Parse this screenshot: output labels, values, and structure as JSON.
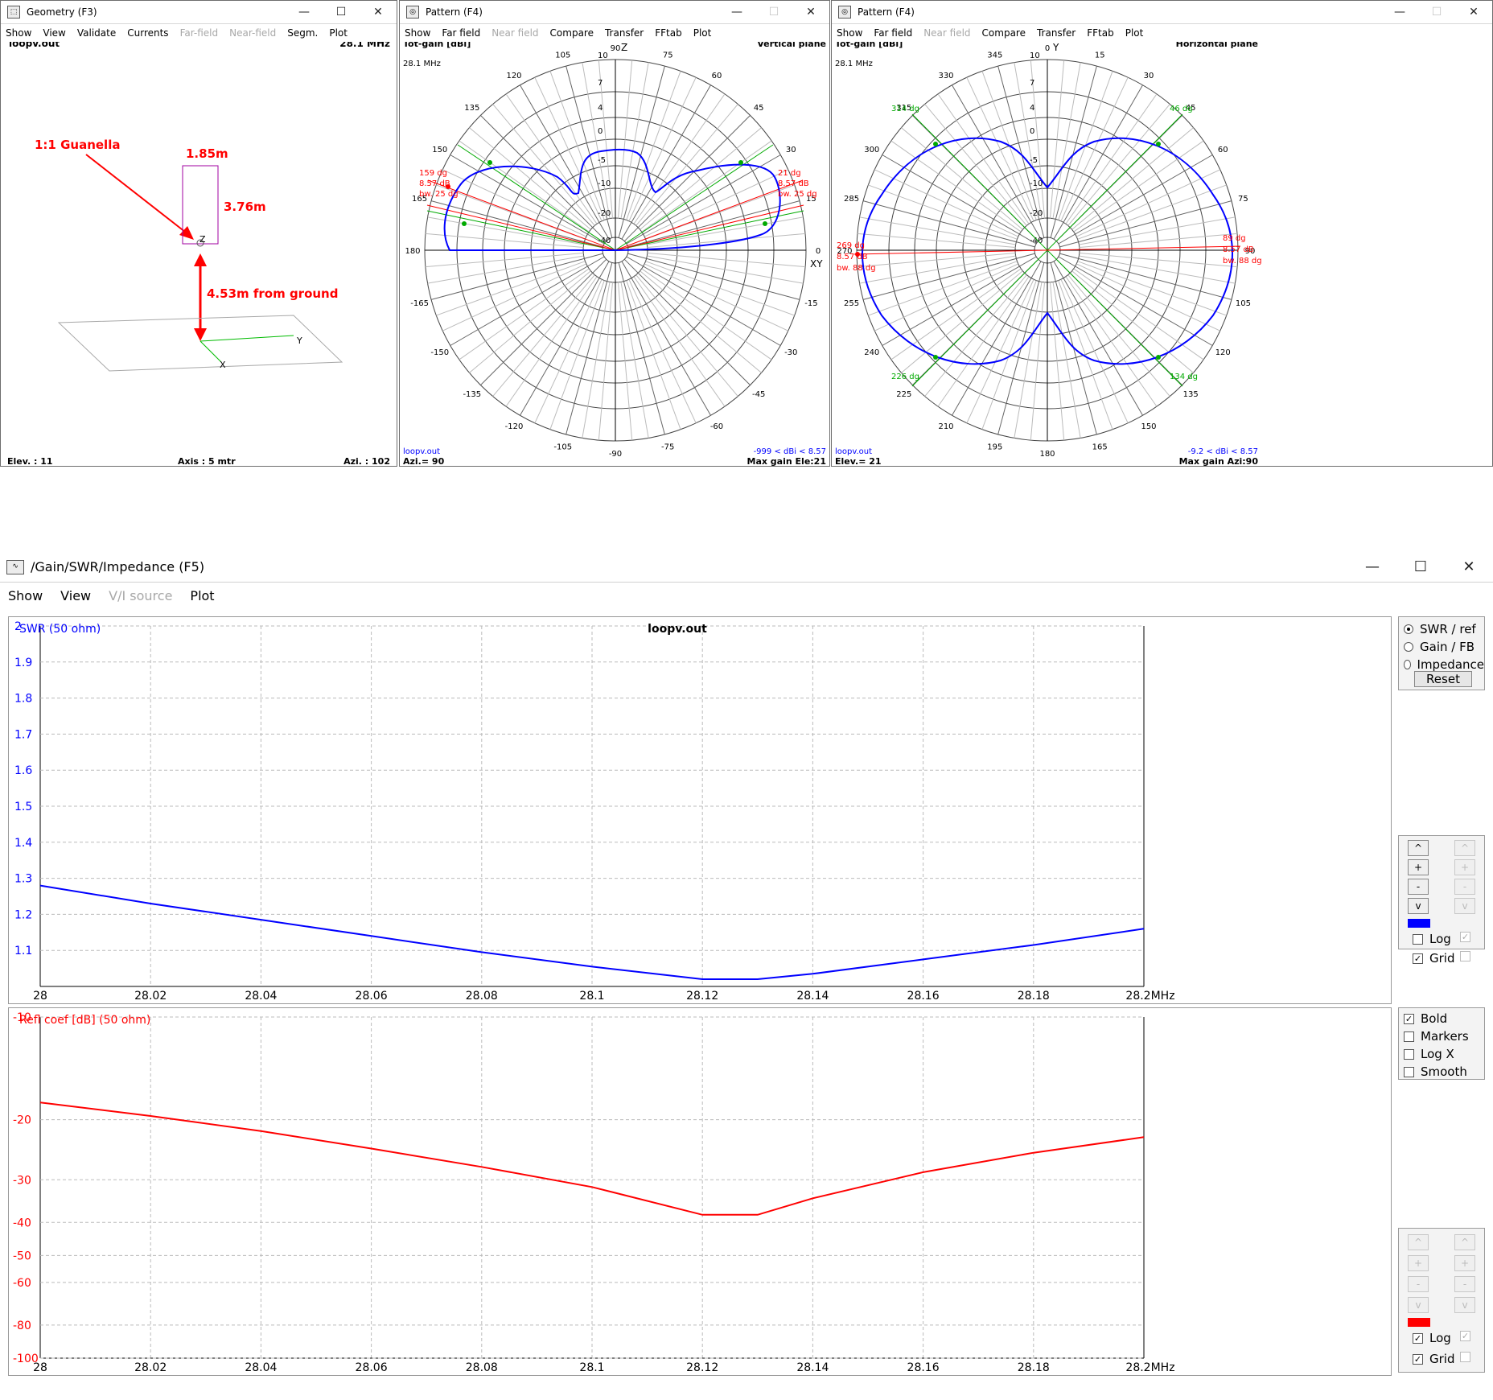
{
  "geometry_window": {
    "title": "Geometry   (F3)",
    "menu": [
      "Show",
      "View",
      "Validate",
      "Currents",
      "Far-field",
      "Near-field",
      "Segm.",
      "Plot"
    ],
    "file": "loopv.out",
    "freq": "28.1 MHz",
    "annotation_balun": "1:1 Guanella",
    "annotation_width": "1.85m",
    "annotation_height": "3.76m",
    "annotation_ground": "4.53m from ground",
    "axis_z": "Z",
    "axis_y": "Y",
    "axis_x": "X",
    "elev": "Elev. : 11",
    "axis_info": "Axis : 5 mtr",
    "azi": "Azi. : 102"
  },
  "pattern_vertical": {
    "title": "Pattern   (F4)",
    "menu": [
      "Show",
      "Far field",
      "Near field",
      "Compare",
      "Transfer",
      "FFtab",
      "Plot"
    ],
    "gain_label": "Tot-gain [dBi]",
    "freq": "28.1 MHz",
    "plane": "Vertical plane",
    "axis_top": "Z",
    "axis_right": "XY",
    "left_marker": [
      "159 dg",
      "8.57 dB",
      "bw. 25 dg"
    ],
    "right_marker": [
      "21 dg",
      "8.57 dB",
      "bw. 25 dg"
    ],
    "ring_labels": [
      "10",
      "7",
      "4",
      "0",
      "-5",
      "-10",
      "-20",
      "-40"
    ],
    "angle_labels": [
      "90",
      "75",
      "60",
      "45",
      "30",
      "15",
      "0",
      "-15",
      "-30",
      "-45",
      "-60",
      "-75",
      "-90",
      "-105",
      "-120",
      "-135",
      "-150",
      "-165",
      "180",
      "165",
      "150",
      "135",
      "120",
      "105"
    ],
    "file": "loopv.out",
    "range": "-999 < dBi < 8.57",
    "azi": "Azi.= 90",
    "max_gain": "Max gain Ele:21"
  },
  "pattern_horizontal": {
    "title": "Pattern   (F4)",
    "menu": [
      "Show",
      "Far field",
      "Near field",
      "Compare",
      "Transfer",
      "FFtab",
      "Plot"
    ],
    "gain_label": "Tot-gain [dBi]",
    "freq": "28.1 MHz",
    "plane": "Horizontal plane",
    "axis_top": "Y",
    "marker_314": "314 dg",
    "marker_46": "46 dg",
    "marker_226": "226 dg",
    "marker_134": "134 dg",
    "left_marker": [
      "269 dg",
      "8.57 dB",
      "bw. 88 dg"
    ],
    "right_marker": [
      "89 dg",
      "8.57 dB",
      "bw. 88 dg"
    ],
    "ring_labels": [
      "10",
      "7",
      "4",
      "0",
      "-5",
      "-10",
      "-20",
      "-40"
    ],
    "angle_labels": [
      "0",
      "15",
      "30",
      "45",
      "60",
      "75",
      "90",
      "105",
      "120",
      "135",
      "150",
      "165",
      "180",
      "195",
      "210",
      "225",
      "240",
      "255",
      "270",
      "285",
      "300",
      "315",
      "330",
      "345"
    ],
    "file": "loopv.out",
    "range": "-9.2 < dBi < 8.57",
    "elev": "Elev.= 21",
    "max_gain": "Max gain Azi:90"
  },
  "gain_window": {
    "title": "/Gain/SWR/Impedance (F5)",
    "menu": [
      "Show",
      "View",
      "V/I source",
      "Plot"
    ],
    "file": "loopv.out",
    "radio_options": [
      "SWR / ref",
      "Gain / FB",
      "Impedance"
    ],
    "radio_selected": "SWR / ref",
    "reset_label": "Reset",
    "log_label": "Log",
    "grid_label": "Grid",
    "swr_log_checked": false,
    "swr_grid_checked": true,
    "refl_log_checked": true,
    "refl_grid_checked": true,
    "options": [
      {
        "label": "Bold",
        "checked": true
      },
      {
        "label": "Markers",
        "checked": false
      },
      {
        "label": "Log X",
        "checked": false
      },
      {
        "label": "Smooth",
        "checked": false
      }
    ],
    "stepper_glyphs": [
      "^",
      "+",
      "-",
      "v"
    ]
  },
  "chart_data": [
    {
      "type": "line",
      "title": "loopv.out",
      "ylabel": "SWR (50 ohm)",
      "xlabel": "MHz",
      "x_tick_labels": [
        "28",
        "28.02",
        "28.04",
        "28.06",
        "28.08",
        "28.1",
        "28.12",
        "28.14",
        "28.16",
        "28.18",
        "28.2MHz"
      ],
      "y_tick_labels": [
        "2",
        "1.9",
        "1.8",
        "1.7",
        "1.6",
        "1.5",
        "1.4",
        "1.3",
        "1.2",
        "1.1"
      ],
      "xlim": [
        28.0,
        28.2
      ],
      "ylim": [
        1.0,
        2.0
      ],
      "grid": true,
      "color": "#0000ff",
      "x": [
        28.0,
        28.02,
        28.04,
        28.06,
        28.08,
        28.1,
        28.12,
        28.13,
        28.14,
        28.16,
        28.18,
        28.2
      ],
      "y": [
        1.28,
        1.23,
        1.185,
        1.14,
        1.095,
        1.055,
        1.02,
        1.02,
        1.035,
        1.075,
        1.115,
        1.16
      ]
    },
    {
      "type": "line",
      "ylabel": "Refl coef [dB] (50 ohm)",
      "xlabel": "MHz",
      "x_tick_labels": [
        "28",
        "28.02",
        "28.04",
        "28.06",
        "28.08",
        "28.1",
        "28.12",
        "28.14",
        "28.16",
        "28.18",
        "28.2MHz"
      ],
      "y_tick_labels": [
        "-10",
        "-20",
        "-30",
        "-40",
        "-50",
        "-60",
        "-80",
        "-100"
      ],
      "xlim": [
        28.0,
        28.2
      ],
      "ylim": [
        -100,
        -10
      ],
      "y_scale": "log",
      "grid": true,
      "color": "#ff0000",
      "x": [
        28.0,
        28.02,
        28.04,
        28.06,
        28.08,
        28.1,
        28.12,
        28.13,
        28.14,
        28.16,
        28.18,
        28.2
      ],
      "y": [
        -17.8,
        -19.5,
        -21.6,
        -24.3,
        -27.5,
        -31.5,
        -38.0,
        -38.0,
        -34.0,
        -28.5,
        -25.0,
        -22.5
      ]
    }
  ]
}
